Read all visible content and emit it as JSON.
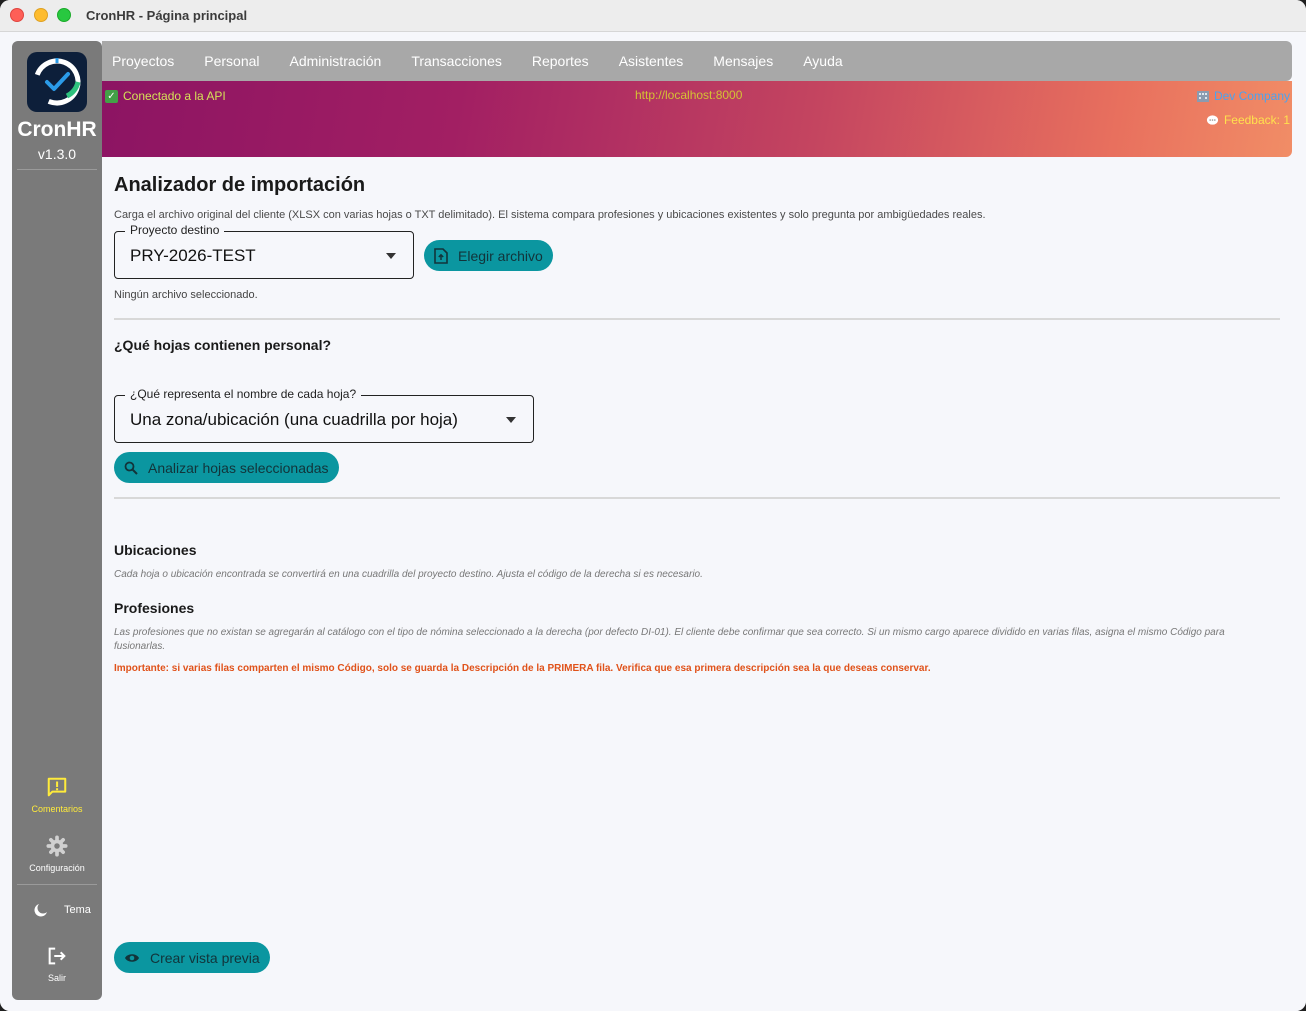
{
  "window": {
    "title": "CronHR - Página principal"
  },
  "sidebar": {
    "app_name": "CronHR",
    "version": "v1.3.0",
    "items": [
      {
        "label": "Comentarios",
        "icon": "feedback-icon"
      },
      {
        "label": "Configuración",
        "icon": "gear-icon"
      },
      {
        "label": "Tema",
        "icon": "moon-icon"
      },
      {
        "label": "Salir",
        "icon": "logout-icon"
      }
    ]
  },
  "nav": [
    "Proyectos",
    "Personal",
    "Administración",
    "Transacciones",
    "Reportes",
    "Asistentes",
    "Mensajes",
    "Ayuda"
  ],
  "banner": {
    "api_status": "Conectado a la API",
    "api_url": "http://localhost:8000",
    "company": "Dev Company",
    "feedback": "Feedback: 1"
  },
  "main": {
    "title": "Analizador de importación",
    "subtitle": "Carga el archivo original del cliente (XLSX con varias hojas o TXT delimitado). El sistema compara profesiones y ubicaciones existentes y solo pregunta por ambigüedades reales.",
    "project_select": {
      "label": "Proyecto destino",
      "value": "PRY-2026-TEST"
    },
    "choose_file_button": "Elegir archivo",
    "file_status": "Ningún archivo seleccionado.",
    "sheets_heading": "¿Qué hojas contienen personal?",
    "sheet_meaning_select": {
      "label": "¿Qué representa el nombre de cada hoja?",
      "value": "Una zona/ubicación (una cuadrilla por hoja)"
    },
    "analyze_button": "Analizar hojas seleccionadas",
    "locations_heading": "Ubicaciones",
    "locations_note": "Cada hoja o ubicación encontrada se convertirá en una cuadrilla del proyecto destino. Ajusta el código de la derecha si es necesario.",
    "professions_heading": "Profesiones",
    "professions_note": "Las profesiones que no existan se agregarán al catálogo con el tipo de nómina seleccionado a la derecha (por defecto DI-01). El cliente debe confirmar que sea correcto. Si un mismo cargo aparece dividido en varias filas, asigna el mismo Código para fusionarlas.",
    "warning": "Importante: si varias filas comparten el mismo Código, solo se guarda la Descripción de la PRIMERA fila. Verifica que esa primera descripción sea la que deseas conservar.",
    "preview_button": "Crear vista previa"
  },
  "colors": {
    "accent": "#0b96a0",
    "sidebar": "#7a7a7a",
    "nav": "#a8a8a8",
    "warning": "#e0521a"
  }
}
